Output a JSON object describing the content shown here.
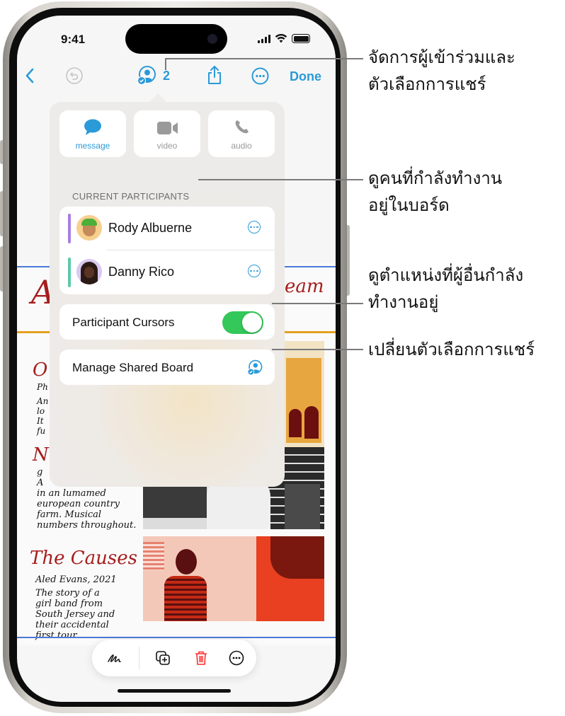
{
  "status_bar": {
    "time": "9:41"
  },
  "toolbar": {
    "back_icon": "chevron-left-icon",
    "undo_icon": "undo-icon",
    "collaboration_icon": "person-checkmark-icon",
    "participant_count": "2",
    "share_icon": "share-icon",
    "more_icon": "ellipsis-circle-icon",
    "done_label": "Done"
  },
  "popover": {
    "communication_buttons": [
      {
        "label": "message",
        "icon": "message-bubble-icon",
        "color": "#2a9ad8"
      },
      {
        "label": "video",
        "icon": "video-camera-icon",
        "color": "#9a9a9a"
      },
      {
        "label": "audio",
        "icon": "phone-icon",
        "color": "#9a9a9a"
      }
    ],
    "section_header": "CURRENT PARTICIPANTS",
    "participants": [
      {
        "name": "Rody Albuerne",
        "cursor_color": "#a97fe0"
      },
      {
        "name": "Danny Rico",
        "cursor_color": "#5ccaa8"
      }
    ],
    "participant_cursors": {
      "label": "Participant Cursors",
      "enabled": true,
      "on_color": "#34c759"
    },
    "manage_shared_board": {
      "label": "Manage Shared Board",
      "icon": "person-checkmark-icon"
    }
  },
  "board": {
    "title_fragment_left": "A",
    "title_fragment_right": "eam",
    "entries": [
      {
        "title": "O",
        "lines": [
          "Ph",
          "An",
          "lo",
          "It",
          "fu"
        ]
      },
      {
        "title": "N",
        "lines": [
          "g",
          "A",
          "in an lumamed",
          "european country",
          "farm. Musical",
          "numbers throughout."
        ]
      },
      {
        "title": "The Causes",
        "lines": [
          "Aled Evans, 2021",
          "The story of a",
          "girl band from",
          "South Jersey and",
          "their accidental",
          "first tour."
        ]
      }
    ]
  },
  "bottom_toolbar": [
    {
      "icon": "pen-scribble-icon"
    },
    {
      "icon": "duplicate-icon"
    },
    {
      "icon": "trash-icon",
      "color": "#ff2d2d"
    },
    {
      "icon": "ellipsis-circle-icon"
    }
  ],
  "callouts": [
    {
      "text_line1": "จัดการผู้เข้าร่วมและ",
      "text_line2": "ตัวเลือกการแชร์"
    },
    {
      "text_line1": "ดูคนที่กำลังทำงาน",
      "text_line2": "อยู่ในบอร์ด"
    },
    {
      "text_line1": "ดูตำแหน่งที่ผู้อื่นกำลัง",
      "text_line2": "ทำงานอยู่"
    },
    {
      "text_line1": "เปลี่ยนตัวเลือกการแชร์"
    }
  ]
}
